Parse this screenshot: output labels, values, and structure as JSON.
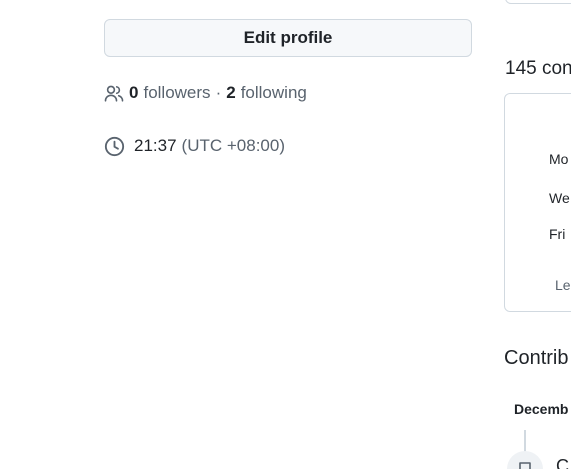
{
  "profile": {
    "edit_button_label": "Edit profile",
    "followers_count": "0",
    "followers_label": "followers",
    "separator": "·",
    "following_count": "2",
    "following_label": "following",
    "local_time": "21:37",
    "timezone": "(UTC +08:00)"
  },
  "contributions": {
    "count_text": "145 con",
    "day_labels": [
      "Mo",
      "We",
      "Fri"
    ],
    "legend_label": "Lea"
  },
  "activity": {
    "title": "Contrib",
    "month": "Decemb",
    "first_item_text": "C"
  },
  "icons": {
    "followers": "people-icon",
    "time": "clock-icon",
    "commit": "repo-icon"
  },
  "colors": {
    "text": "#1f2328",
    "muted": "#59636e",
    "border": "#d1d9e0",
    "button_bg": "#f6f8fa"
  }
}
